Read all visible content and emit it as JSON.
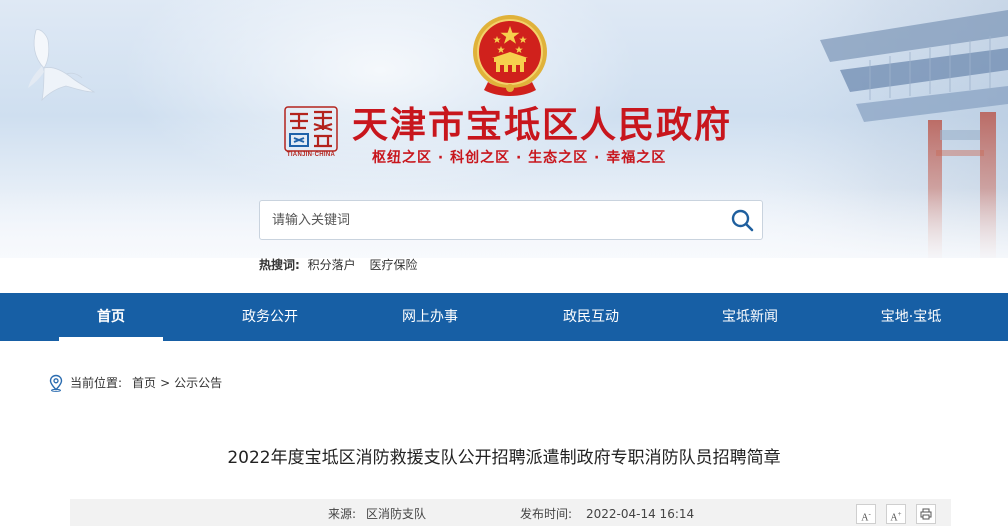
{
  "header": {
    "site_title": "天津市宝坻区人民政府",
    "slogan": "枢纽之区 · 科创之区 · 生态之区 · 幸福之区",
    "logo_caption": "TIANJIN·CHINA"
  },
  "search": {
    "placeholder": "请输入关键词",
    "value": ""
  },
  "hot_search": {
    "label": "热搜词:",
    "terms": [
      "积分落户",
      "医疗保险"
    ]
  },
  "nav": {
    "items": [
      {
        "label": "首页",
        "active": true
      },
      {
        "label": "政务公开",
        "active": false
      },
      {
        "label": "网上办事",
        "active": false
      },
      {
        "label": "政民互动",
        "active": false
      },
      {
        "label": "宝坻新闻",
        "active": false
      },
      {
        "label": "宝地·宝坻",
        "active": false
      }
    ]
  },
  "breadcrumb": {
    "prefix": "当前位置:",
    "items": [
      "首页",
      "公示公告"
    ],
    "separator": ">"
  },
  "article": {
    "title": "2022年度宝坻区消防救援支队公开招聘派遣制政府专职消防队员招聘简章",
    "source_label": "来源:",
    "source_value": "区消防支队",
    "date_label": "发布时间:",
    "date_value": "2022-04-14 16:14"
  },
  "tools": {
    "font_smaller": "A",
    "font_larger": "A",
    "print": "print-icon"
  },
  "colors": {
    "brand_red": "#c8161d",
    "nav_blue": "#175fa5",
    "meta_bg": "#f2f2f2"
  }
}
